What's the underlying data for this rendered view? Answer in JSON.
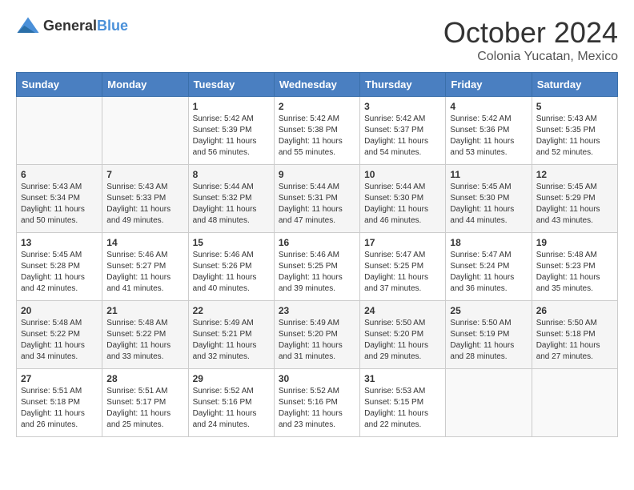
{
  "header": {
    "logo_general": "General",
    "logo_blue": "Blue",
    "month": "October 2024",
    "location": "Colonia Yucatan, Mexico"
  },
  "days_of_week": [
    "Sunday",
    "Monday",
    "Tuesday",
    "Wednesday",
    "Thursday",
    "Friday",
    "Saturday"
  ],
  "weeks": [
    [
      {
        "day": "",
        "sunrise": "",
        "sunset": "",
        "daylight": ""
      },
      {
        "day": "",
        "sunrise": "",
        "sunset": "",
        "daylight": ""
      },
      {
        "day": "1",
        "sunrise": "Sunrise: 5:42 AM",
        "sunset": "Sunset: 5:39 PM",
        "daylight": "Daylight: 11 hours and 56 minutes."
      },
      {
        "day": "2",
        "sunrise": "Sunrise: 5:42 AM",
        "sunset": "Sunset: 5:38 PM",
        "daylight": "Daylight: 11 hours and 55 minutes."
      },
      {
        "day": "3",
        "sunrise": "Sunrise: 5:42 AM",
        "sunset": "Sunset: 5:37 PM",
        "daylight": "Daylight: 11 hours and 54 minutes."
      },
      {
        "day": "4",
        "sunrise": "Sunrise: 5:42 AM",
        "sunset": "Sunset: 5:36 PM",
        "daylight": "Daylight: 11 hours and 53 minutes."
      },
      {
        "day": "5",
        "sunrise": "Sunrise: 5:43 AM",
        "sunset": "Sunset: 5:35 PM",
        "daylight": "Daylight: 11 hours and 52 minutes."
      }
    ],
    [
      {
        "day": "6",
        "sunrise": "Sunrise: 5:43 AM",
        "sunset": "Sunset: 5:34 PM",
        "daylight": "Daylight: 11 hours and 50 minutes."
      },
      {
        "day": "7",
        "sunrise": "Sunrise: 5:43 AM",
        "sunset": "Sunset: 5:33 PM",
        "daylight": "Daylight: 11 hours and 49 minutes."
      },
      {
        "day": "8",
        "sunrise": "Sunrise: 5:44 AM",
        "sunset": "Sunset: 5:32 PM",
        "daylight": "Daylight: 11 hours and 48 minutes."
      },
      {
        "day": "9",
        "sunrise": "Sunrise: 5:44 AM",
        "sunset": "Sunset: 5:31 PM",
        "daylight": "Daylight: 11 hours and 47 minutes."
      },
      {
        "day": "10",
        "sunrise": "Sunrise: 5:44 AM",
        "sunset": "Sunset: 5:30 PM",
        "daylight": "Daylight: 11 hours and 46 minutes."
      },
      {
        "day": "11",
        "sunrise": "Sunrise: 5:45 AM",
        "sunset": "Sunset: 5:30 PM",
        "daylight": "Daylight: 11 hours and 44 minutes."
      },
      {
        "day": "12",
        "sunrise": "Sunrise: 5:45 AM",
        "sunset": "Sunset: 5:29 PM",
        "daylight": "Daylight: 11 hours and 43 minutes."
      }
    ],
    [
      {
        "day": "13",
        "sunrise": "Sunrise: 5:45 AM",
        "sunset": "Sunset: 5:28 PM",
        "daylight": "Daylight: 11 hours and 42 minutes."
      },
      {
        "day": "14",
        "sunrise": "Sunrise: 5:46 AM",
        "sunset": "Sunset: 5:27 PM",
        "daylight": "Daylight: 11 hours and 41 minutes."
      },
      {
        "day": "15",
        "sunrise": "Sunrise: 5:46 AM",
        "sunset": "Sunset: 5:26 PM",
        "daylight": "Daylight: 11 hours and 40 minutes."
      },
      {
        "day": "16",
        "sunrise": "Sunrise: 5:46 AM",
        "sunset": "Sunset: 5:25 PM",
        "daylight": "Daylight: 11 hours and 39 minutes."
      },
      {
        "day": "17",
        "sunrise": "Sunrise: 5:47 AM",
        "sunset": "Sunset: 5:25 PM",
        "daylight": "Daylight: 11 hours and 37 minutes."
      },
      {
        "day": "18",
        "sunrise": "Sunrise: 5:47 AM",
        "sunset": "Sunset: 5:24 PM",
        "daylight": "Daylight: 11 hours and 36 minutes."
      },
      {
        "day": "19",
        "sunrise": "Sunrise: 5:48 AM",
        "sunset": "Sunset: 5:23 PM",
        "daylight": "Daylight: 11 hours and 35 minutes."
      }
    ],
    [
      {
        "day": "20",
        "sunrise": "Sunrise: 5:48 AM",
        "sunset": "Sunset: 5:22 PM",
        "daylight": "Daylight: 11 hours and 34 minutes."
      },
      {
        "day": "21",
        "sunrise": "Sunrise: 5:48 AM",
        "sunset": "Sunset: 5:22 PM",
        "daylight": "Daylight: 11 hours and 33 minutes."
      },
      {
        "day": "22",
        "sunrise": "Sunrise: 5:49 AM",
        "sunset": "Sunset: 5:21 PM",
        "daylight": "Daylight: 11 hours and 32 minutes."
      },
      {
        "day": "23",
        "sunrise": "Sunrise: 5:49 AM",
        "sunset": "Sunset: 5:20 PM",
        "daylight": "Daylight: 11 hours and 31 minutes."
      },
      {
        "day": "24",
        "sunrise": "Sunrise: 5:50 AM",
        "sunset": "Sunset: 5:20 PM",
        "daylight": "Daylight: 11 hours and 29 minutes."
      },
      {
        "day": "25",
        "sunrise": "Sunrise: 5:50 AM",
        "sunset": "Sunset: 5:19 PM",
        "daylight": "Daylight: 11 hours and 28 minutes."
      },
      {
        "day": "26",
        "sunrise": "Sunrise: 5:50 AM",
        "sunset": "Sunset: 5:18 PM",
        "daylight": "Daylight: 11 hours and 27 minutes."
      }
    ],
    [
      {
        "day": "27",
        "sunrise": "Sunrise: 5:51 AM",
        "sunset": "Sunset: 5:18 PM",
        "daylight": "Daylight: 11 hours and 26 minutes."
      },
      {
        "day": "28",
        "sunrise": "Sunrise: 5:51 AM",
        "sunset": "Sunset: 5:17 PM",
        "daylight": "Daylight: 11 hours and 25 minutes."
      },
      {
        "day": "29",
        "sunrise": "Sunrise: 5:52 AM",
        "sunset": "Sunset: 5:16 PM",
        "daylight": "Daylight: 11 hours and 24 minutes."
      },
      {
        "day": "30",
        "sunrise": "Sunrise: 5:52 AM",
        "sunset": "Sunset: 5:16 PM",
        "daylight": "Daylight: 11 hours and 23 minutes."
      },
      {
        "day": "31",
        "sunrise": "Sunrise: 5:53 AM",
        "sunset": "Sunset: 5:15 PM",
        "daylight": "Daylight: 11 hours and 22 minutes."
      },
      {
        "day": "",
        "sunrise": "",
        "sunset": "",
        "daylight": ""
      },
      {
        "day": "",
        "sunrise": "",
        "sunset": "",
        "daylight": ""
      }
    ]
  ]
}
